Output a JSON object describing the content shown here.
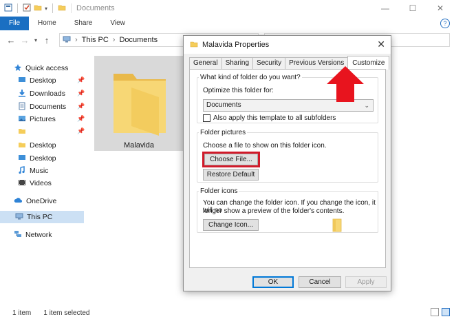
{
  "explorer": {
    "window_title": "Documents",
    "ribbon_tabs": [
      "File",
      "Home",
      "Share",
      "View"
    ],
    "breadcrumb": [
      "This PC",
      "Documents"
    ],
    "sidebar": {
      "items": [
        {
          "label": "Quick access",
          "icon": "star-icon",
          "pinned": false
        },
        {
          "label": "Desktop",
          "icon": "desktop-icon",
          "pinned": true
        },
        {
          "label": "Downloads",
          "icon": "download-icon",
          "pinned": true
        },
        {
          "label": "Documents",
          "icon": "documents-icon",
          "pinned": true
        },
        {
          "label": "Pictures",
          "icon": "pictures-icon",
          "pinned": true
        },
        {
          "label": "",
          "icon": "folder-icon",
          "pinned": true
        },
        {
          "label": "Desktop",
          "icon": "folder-icon",
          "pinned": false
        },
        {
          "label": "Desktop",
          "icon": "desktop-icon",
          "pinned": false
        },
        {
          "label": "Music",
          "icon": "music-icon",
          "pinned": false
        },
        {
          "label": "Videos",
          "icon": "videos-icon",
          "pinned": false
        },
        {
          "label": "OneDrive",
          "icon": "cloud-icon",
          "pinned": false
        },
        {
          "label": "This PC",
          "icon": "computer-icon",
          "pinned": false
        },
        {
          "label": "Network",
          "icon": "network-icon",
          "pinned": false
        }
      ]
    },
    "files": [
      {
        "name": "Malavida",
        "type": "folder"
      }
    ],
    "status": {
      "count": "1 item",
      "selected": "1 item selected"
    }
  },
  "dialog": {
    "title": "Malavida Properties",
    "close": "✕",
    "tabs": [
      "General",
      "Sharing",
      "Security",
      "Previous Versions",
      "Customize"
    ],
    "active_tab": "Customize",
    "folder_type": {
      "legend": "What kind of folder do you want?",
      "optimize_label": "Optimize this folder for:",
      "selected_option": "Documents",
      "apply_checkbox_label": "Also apply this template to all subfolders"
    },
    "folder_pictures": {
      "legend": "Folder pictures",
      "hint": "Choose a file to show on this folder icon.",
      "choose_file": "Choose File...",
      "restore_default": "Restore Default"
    },
    "folder_icons": {
      "legend": "Folder icons",
      "hint_line1": "You can change the folder icon. If you change the icon, it will no",
      "hint_line2": "longer show a preview of the folder's contents.",
      "change_icon": "Change Icon..."
    },
    "buttons": {
      "ok": "OK",
      "cancel": "Cancel",
      "apply": "Apply"
    }
  },
  "colors": {
    "accent": "#1a6fc2",
    "annotation_red": "#e8141e",
    "folder_yellow": "#f5cd5a"
  }
}
